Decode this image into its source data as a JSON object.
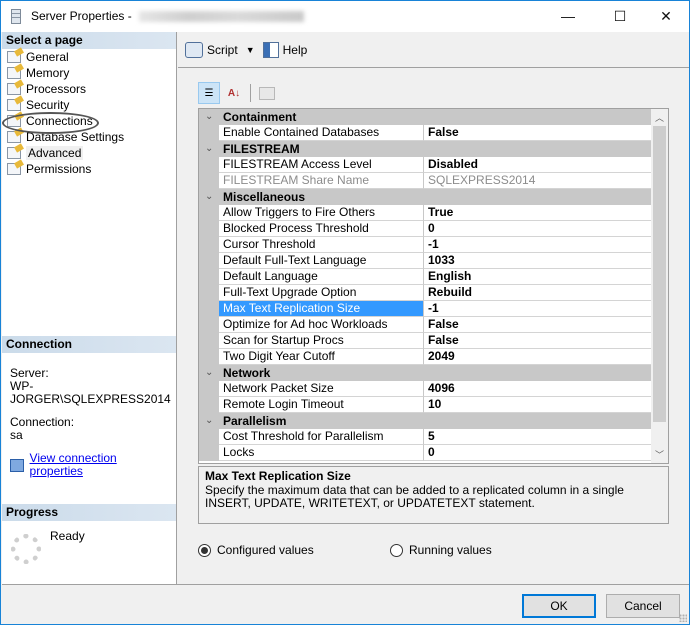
{
  "window": {
    "title": "Server Properties - ",
    "title_redacted": true,
    "controls": {
      "minimize": "—",
      "maximize": "☐",
      "close": "✕"
    }
  },
  "sidebar": {
    "select_page_header": "Select a page",
    "pages": [
      {
        "label": "General"
      },
      {
        "label": "Memory"
      },
      {
        "label": "Processors"
      },
      {
        "label": "Security"
      },
      {
        "label": "Connections",
        "annotated": true
      },
      {
        "label": "Database Settings"
      },
      {
        "label": "Advanced",
        "selected": true
      },
      {
        "label": "Permissions"
      }
    ],
    "connection": {
      "header": "Connection",
      "server_label": "Server:",
      "server_value": "WP-JORGER\\SQLEXPRESS2014",
      "connection_label": "Connection:",
      "connection_value": "sa",
      "view_properties_link": "View connection properties"
    },
    "progress": {
      "header": "Progress",
      "status": "Ready"
    }
  },
  "toolbar": {
    "script_label": "Script",
    "help_label": "Help"
  },
  "grid_toolbar": {
    "categorized_icon": "categorized-icon",
    "alphabetical_icon": "sort-az-icon",
    "property_pages_icon": "property-pages-icon"
  },
  "property_grid": {
    "categories": [
      {
        "name": "Containment",
        "rows": [
          {
            "name": "Enable Contained Databases",
            "value": "False"
          }
        ]
      },
      {
        "name": "FILESTREAM",
        "rows": [
          {
            "name": "FILESTREAM Access Level",
            "value": "Disabled"
          },
          {
            "name": "FILESTREAM Share Name",
            "value": "SQLEXPRESS2014",
            "disabled": true
          }
        ]
      },
      {
        "name": "Miscellaneous",
        "rows": [
          {
            "name": "Allow Triggers to Fire Others",
            "value": "True"
          },
          {
            "name": "Blocked Process Threshold",
            "value": "0"
          },
          {
            "name": "Cursor Threshold",
            "value": "-1"
          },
          {
            "name": "Default Full-Text Language",
            "value": "1033"
          },
          {
            "name": "Default Language",
            "value": "English"
          },
          {
            "name": "Full-Text Upgrade Option",
            "value": "Rebuild"
          },
          {
            "name": "Max Text Replication Size",
            "value": "-1",
            "selected": true
          },
          {
            "name": "Optimize for Ad hoc Workloads",
            "value": "False"
          },
          {
            "name": "Scan for Startup Procs",
            "value": "False"
          },
          {
            "name": "Two Digit Year Cutoff",
            "value": "2049"
          }
        ]
      },
      {
        "name": "Network",
        "rows": [
          {
            "name": "Network Packet Size",
            "value": "4096"
          },
          {
            "name": "Remote Login Timeout",
            "value": "10"
          }
        ]
      },
      {
        "name": "Parallelism",
        "rows": [
          {
            "name": "Cost Threshold for Parallelism",
            "value": "5"
          },
          {
            "name": "Locks",
            "value": "0"
          }
        ]
      }
    ]
  },
  "description": {
    "title": "Max Text Replication Size",
    "text": "Specify the maximum data that can be added to a replicated column in a single INSERT, UPDATE, WRITETEXT, or UPDATETEXT statement."
  },
  "value_mode": {
    "configured_label": "Configured values",
    "running_label": "Running values",
    "selected": "configured"
  },
  "buttons": {
    "ok": "OK",
    "cancel": "Cancel"
  }
}
